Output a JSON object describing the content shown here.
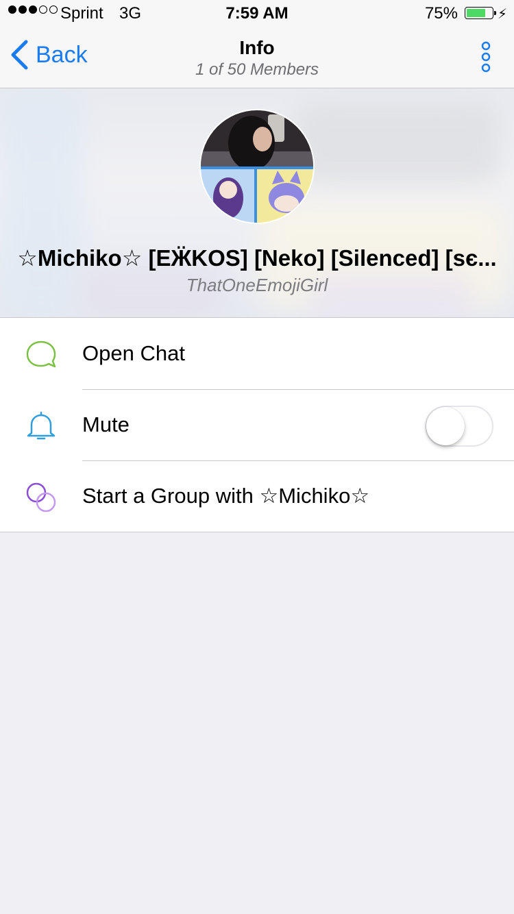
{
  "status_bar": {
    "carrier": "Sprint",
    "network": "3G",
    "time": "7:59 AM",
    "battery_percent": "75%",
    "battery_level": 0.75,
    "signal_bars_filled": 3,
    "signal_bars_total": 5
  },
  "nav": {
    "back_label": "Back",
    "title": "Info",
    "subtitle": "1 of 50 Members",
    "more_icon": "more-vertical-icon"
  },
  "profile": {
    "display_name": "☆Michiko☆ [EӜKOS] [Neko] [Silenced] [sє...",
    "username": "ThatOneEmojiGirl"
  },
  "actions": [
    {
      "label": "Open Chat",
      "icon": "chat-bubble-icon",
      "color": "#7ac143"
    },
    {
      "label": "Mute",
      "icon": "bell-icon",
      "color": "#2f9ee0",
      "toggle_on": false
    },
    {
      "label": "Start a Group with ☆Michiko☆",
      "icon": "group-circles-icon",
      "color": "#a76ee0"
    }
  ],
  "colors": {
    "accent": "#1a7cf4",
    "battery": "#4cd964",
    "background": "#efeff4"
  }
}
